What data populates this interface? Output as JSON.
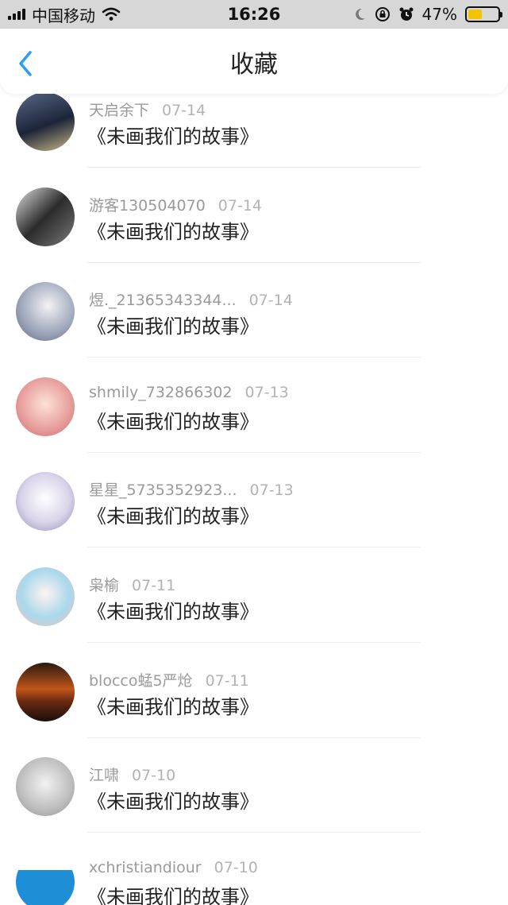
{
  "status_bar": {
    "carrier": "中国移动",
    "time": "16:26",
    "battery": "47%",
    "battery_level": 0.47
  },
  "nav": {
    "title": "收藏"
  },
  "items": [
    {
      "user": "天启余下",
      "date": "07-14",
      "title": "《未画我们的故事》",
      "avatar_bg": "linear-gradient(160deg,#5a6a8a,#1c2438 55%,#c9b98a)"
    },
    {
      "user": "游客130504070",
      "date": "07-14",
      "title": "《未画我们的故事》",
      "avatar_bg": "linear-gradient(135deg,#e0e0e0,#2b2b2b 50%,#7a7a7a)"
    },
    {
      "user": "煜._21365343344...",
      "date": "07-14",
      "title": "《未画我们的故事》",
      "avatar_bg": "radial-gradient(circle at 55% 40%,#f3f3f5,#9aa3b8 60%,#5c6478)"
    },
    {
      "user": "shmily_732866302",
      "date": "07-13",
      "title": "《未画我们的故事》",
      "avatar_bg": "radial-gradient(circle at 50% 45%,#fbe3d6,#e9a2a0 55%,#c86a6a)"
    },
    {
      "user": "星星_5735352923...",
      "date": "07-13",
      "title": "《未画我们的故事》",
      "avatar_bg": "radial-gradient(circle at 50% 45%,#ffffff,#d9d4ea 55%,#8f86b8)"
    },
    {
      "user": "枭榆",
      "date": "07-11",
      "title": "《未画我们的故事》",
      "avatar_bg": "radial-gradient(circle at 50% 45%,#fff4f0,#a9d8ec 55%,#f3c3b8)"
    },
    {
      "user": "blocco蜢5严炝",
      "date": "07-11",
      "title": "《未画我们的故事》",
      "avatar_bg": "linear-gradient(180deg,#2a1a10,#c2551a 45%,#6b2a10 65%,#1a0f0a)"
    },
    {
      "user": "江啸",
      "date": "07-10",
      "title": "《未画我们的故事》",
      "avatar_bg": "radial-gradient(circle at 50% 45%,#f2f2f2,#bdbdbd 60%,#8d8d8d)"
    },
    {
      "user": "xchristiandiour",
      "date": "07-10",
      "title": "《未画我们的故事》",
      "avatar_bg": "linear-gradient(180deg,#ffffff 0%,#ffffff 30%,#1e8fd6 30%,#1e8fd6 100%)"
    }
  ]
}
